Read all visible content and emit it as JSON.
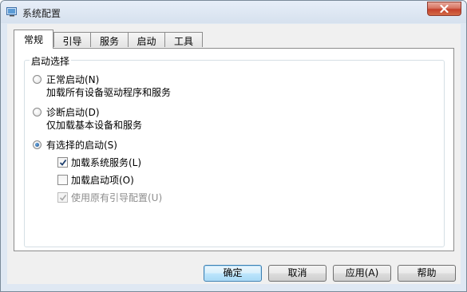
{
  "window": {
    "title": "系统配置",
    "close_label": "x"
  },
  "tabs": [
    {
      "label": "常规",
      "active": true
    },
    {
      "label": "引导",
      "active": false
    },
    {
      "label": "服务",
      "active": false
    },
    {
      "label": "启动",
      "active": false
    },
    {
      "label": "工具",
      "active": false
    }
  ],
  "startup_group": {
    "legend": "启动选择",
    "normal": {
      "label": "正常启动(N)",
      "description": "加载所有设备驱动程序和服务",
      "selected": false
    },
    "diagnostic": {
      "label": "诊断启动(D)",
      "description": "仅加载基本设备和服务",
      "selected": false
    },
    "selective": {
      "label": "有选择的启动(S)",
      "selected": true,
      "options": [
        {
          "label": "加载系统服务(L)",
          "checked": true,
          "enabled": true
        },
        {
          "label": "加载启动项(O)",
          "checked": false,
          "enabled": true
        },
        {
          "label": "使用原有引导配置(U)",
          "checked": true,
          "enabled": false
        }
      ]
    }
  },
  "buttons": {
    "ok": "确定",
    "cancel": "取消",
    "apply": "应用(A)",
    "help": "帮助"
  },
  "colors": {
    "window_frame": "#dfe8f3",
    "close_button": "#c4412b",
    "default_button_border": "#3c7fb1",
    "disabled_text": "#8d8d8d"
  },
  "icons": {
    "app": "system-config-icon",
    "close": "close-icon",
    "checkmark": "checkmark-icon"
  }
}
